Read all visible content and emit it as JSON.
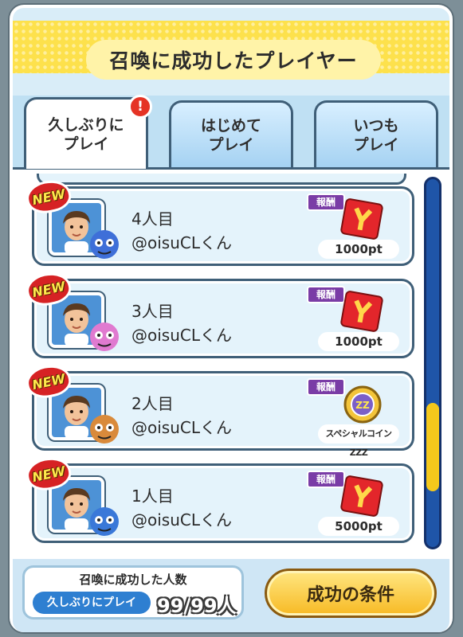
{
  "header": {
    "title": "召喚に成功したプレイヤー"
  },
  "tabs": [
    {
      "label": "久しぶりに\nプレイ",
      "active": true,
      "alert": "!"
    },
    {
      "label": "はじめて\nプレイ",
      "active": false
    },
    {
      "label": "いつも\nプレイ",
      "active": false
    }
  ],
  "players": [
    {
      "badge": "NEW",
      "order": "4人目",
      "name": "@oisuCLくん",
      "reward_tag": "報酬",
      "reward": "1000pt",
      "reward_icon": "yokai-point-card-icon",
      "yokai_color": "#3e6fd8"
    },
    {
      "badge": "NEW",
      "order": "3人目",
      "name": "@oisuCLくん",
      "reward_tag": "報酬",
      "reward": "1000pt",
      "reward_icon": "yokai-point-card-icon",
      "yokai_color": "#e07ad0"
    },
    {
      "badge": "NEW",
      "order": "2人目",
      "name": "@oisuCLくん",
      "reward_tag": "報酬",
      "reward": "スペシャルコインZZZ",
      "reward_icon": "special-coin-icon",
      "yokai_color": "#d98a3b"
    },
    {
      "badge": "NEW",
      "order": "1人目",
      "name": "@oisuCLくん",
      "reward_tag": "報酬",
      "reward": "5000pt",
      "reward_icon": "yokai-point-card-icon",
      "yokai_color": "#3a78d8"
    }
  ],
  "scrollbar": {
    "position": 0.8,
    "visible_fraction": 0.24
  },
  "footer": {
    "count_label": "召喚に成功した人数",
    "count_category": "久しぶりにプレイ",
    "count_value": "99/99人",
    "condition_button": "成功の条件"
  },
  "colors": {
    "accent_yellow": "#fde14c",
    "panel_blue": "#d9edf8",
    "reward_red": "#e3262b",
    "new_red": "#d62224",
    "reward_tag_purple": "#7a3ca6"
  }
}
